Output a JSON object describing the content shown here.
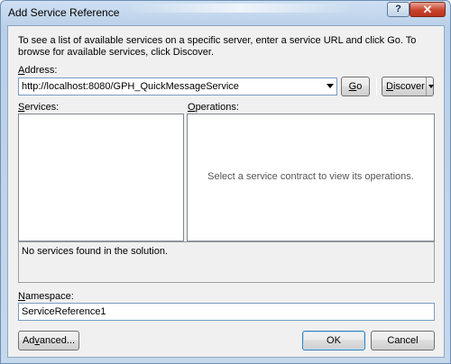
{
  "window": {
    "title": "Add Service Reference",
    "help_label": "?",
    "close_label": "✕"
  },
  "intro": "To see a list of available services on a specific server, enter a service URL and click Go. To browse for available services, click Discover.",
  "address": {
    "label_key": "A",
    "label_rest": "ddress:",
    "value": "http://localhost:8080/GPH_QuickMessageService",
    "go_key": "G",
    "go_rest": "o",
    "discover_key": "D",
    "discover_rest": "iscover"
  },
  "services": {
    "label_key": "S",
    "label_rest": "ervices:"
  },
  "operations": {
    "label_key": "O",
    "label_rest": "perations:",
    "empty_message": "Select a service contract to view its operations."
  },
  "status": "No services found in the solution.",
  "namespace": {
    "label_key": "N",
    "label_rest": "amespace:",
    "value": "ServiceReference1"
  },
  "buttons": {
    "advanced_pre": "Ad",
    "advanced_key": "v",
    "advanced_post": "anced...",
    "ok": "OK",
    "cancel": "Cancel"
  }
}
